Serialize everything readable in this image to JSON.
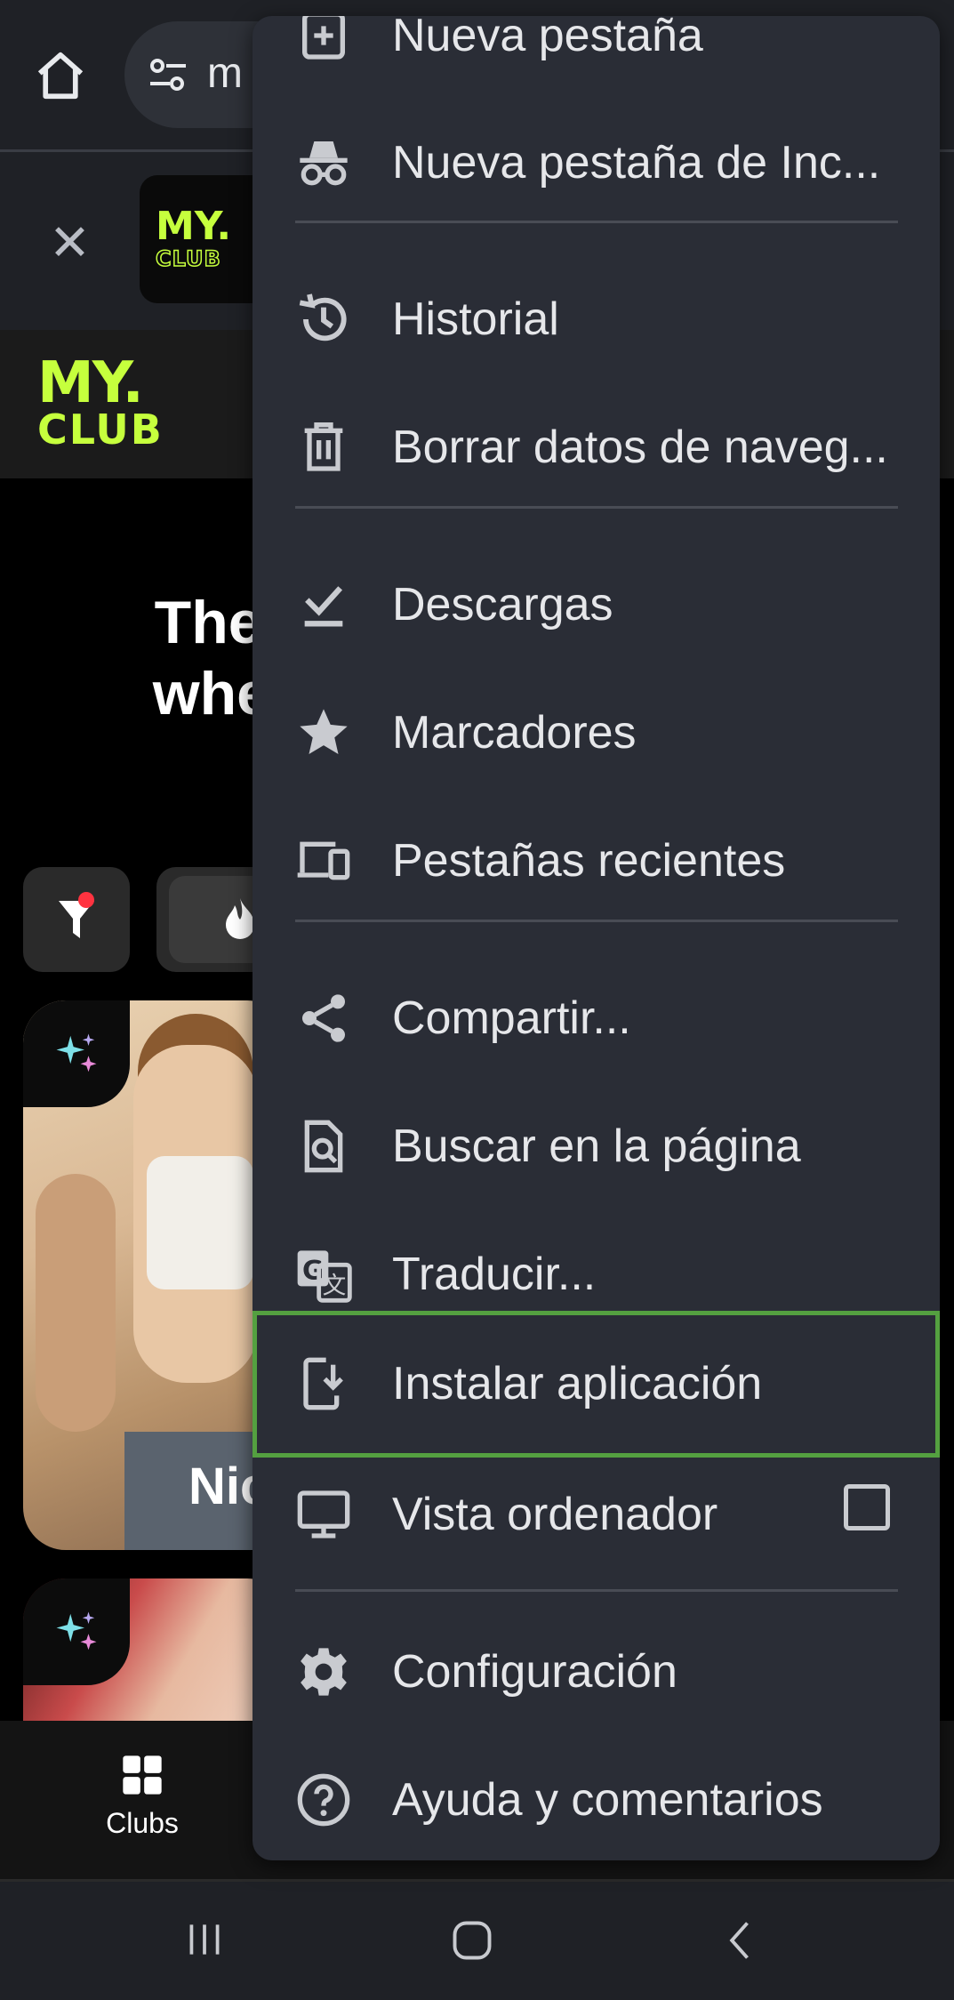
{
  "browser": {
    "url_partial": "m"
  },
  "banner": {
    "logo_text": "MY.",
    "logo_sub": "CLUB"
  },
  "site": {
    "logo_my": "MY.",
    "logo_club": "CLUB",
    "hero_line1": "The w",
    "hero_line2": "where",
    "card1_name": "Nic"
  },
  "bottom_nav": {
    "clubs_label": "Clubs"
  },
  "menu": {
    "items": [
      {
        "label": "Nueva pestaña",
        "icon": "new-tab-icon"
      },
      {
        "label": "Nueva pestaña de Inc...",
        "icon": "incognito-icon"
      },
      {
        "label": "Historial",
        "icon": "history-icon"
      },
      {
        "label": "Borrar datos de naveg...",
        "icon": "trash-icon"
      },
      {
        "label": "Descargas",
        "icon": "download-done-icon"
      },
      {
        "label": "Marcadores",
        "icon": "star-icon"
      },
      {
        "label": "Pestañas recientes",
        "icon": "devices-icon"
      },
      {
        "label": "Compartir...",
        "icon": "share-icon"
      },
      {
        "label": "Buscar en la página",
        "icon": "find-in-page-icon"
      },
      {
        "label": "Traducir...",
        "icon": "translate-icon"
      },
      {
        "label": "Instalar aplicación",
        "icon": "install-app-icon"
      },
      {
        "label": "Vista ordenador",
        "icon": "desktop-icon",
        "checked": false
      },
      {
        "label": "Configuración",
        "icon": "gear-icon"
      },
      {
        "label": "Ayuda y comentarios",
        "icon": "help-icon"
      }
    ]
  },
  "colors": {
    "accent_green": "#c6ff3d",
    "highlight": "#54a040",
    "menu_bg": "#2a2d36"
  }
}
